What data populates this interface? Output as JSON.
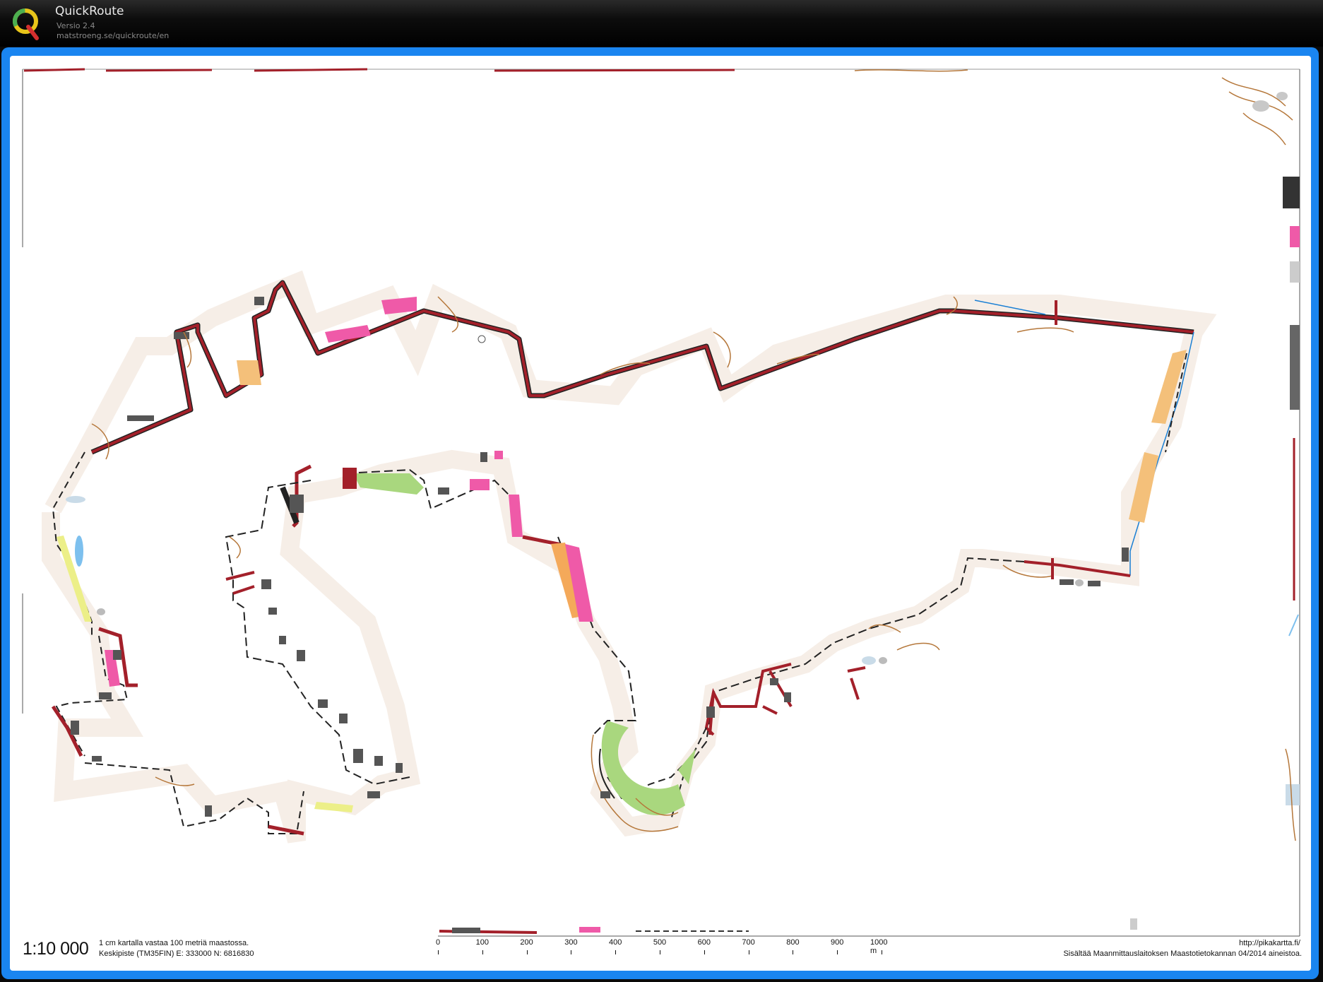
{
  "app": {
    "title": "QuickRoute",
    "version": "Versio 2.4",
    "url": "matstroeng.se/quickroute/en"
  },
  "colors": {
    "window_border": "#1a85f0",
    "road": "#a3202a",
    "building": "#555555",
    "contour": "#b5773a",
    "park": "#a9d77e",
    "residential": "#f4c07a",
    "commercial": "#ef5aa8",
    "water": "#7dc0ee"
  },
  "map": {
    "scale": "1:10 000",
    "scale_note": "1 cm kartalla vastaa 100 metriä maastossa.",
    "center_point": "Keskipiste (TM35FIN)  E: 333000  N: 6816830",
    "source_url": "http://pikakartta.fi/",
    "attribution": "Sisältää Maanmittauslaitoksen Maastotietokannan 04/2014 aineistoa.",
    "scalebar": [
      "0",
      "100",
      "200",
      "300",
      "400",
      "500",
      "600",
      "700",
      "800",
      "900",
      "1000 m"
    ]
  }
}
